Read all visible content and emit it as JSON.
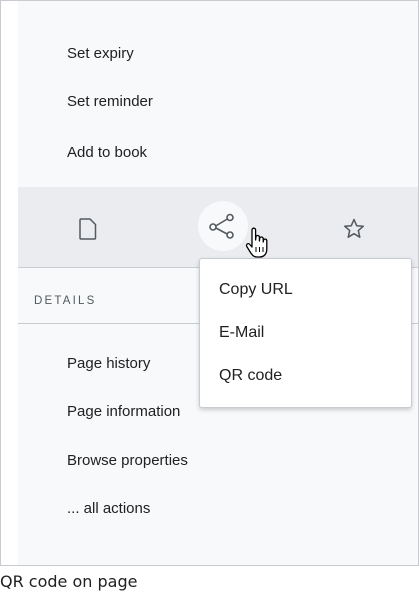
{
  "menu": {
    "top_items": [
      {
        "label": "Set expiry"
      },
      {
        "label": "Set reminder"
      },
      {
        "label": "Add to book"
      }
    ]
  },
  "toolbar": {
    "icons": [
      "page-icon",
      "share-icon",
      "star-icon"
    ]
  },
  "details": {
    "heading": "DETAILS",
    "items": [
      {
        "label": "Page history"
      },
      {
        "label": "Page information"
      },
      {
        "label": "Browse properties"
      },
      {
        "label": "... all actions"
      }
    ]
  },
  "share_popup": {
    "items": [
      {
        "label": "Copy URL"
      },
      {
        "label": "E-Mail"
      },
      {
        "label": "QR code"
      }
    ]
  },
  "caption": "QR code on page",
  "colors": {
    "panel_bg": "#f8f9fa",
    "toolbar_bg": "#eaecf0",
    "border": "#c8ccd1",
    "text": "#202122"
  }
}
